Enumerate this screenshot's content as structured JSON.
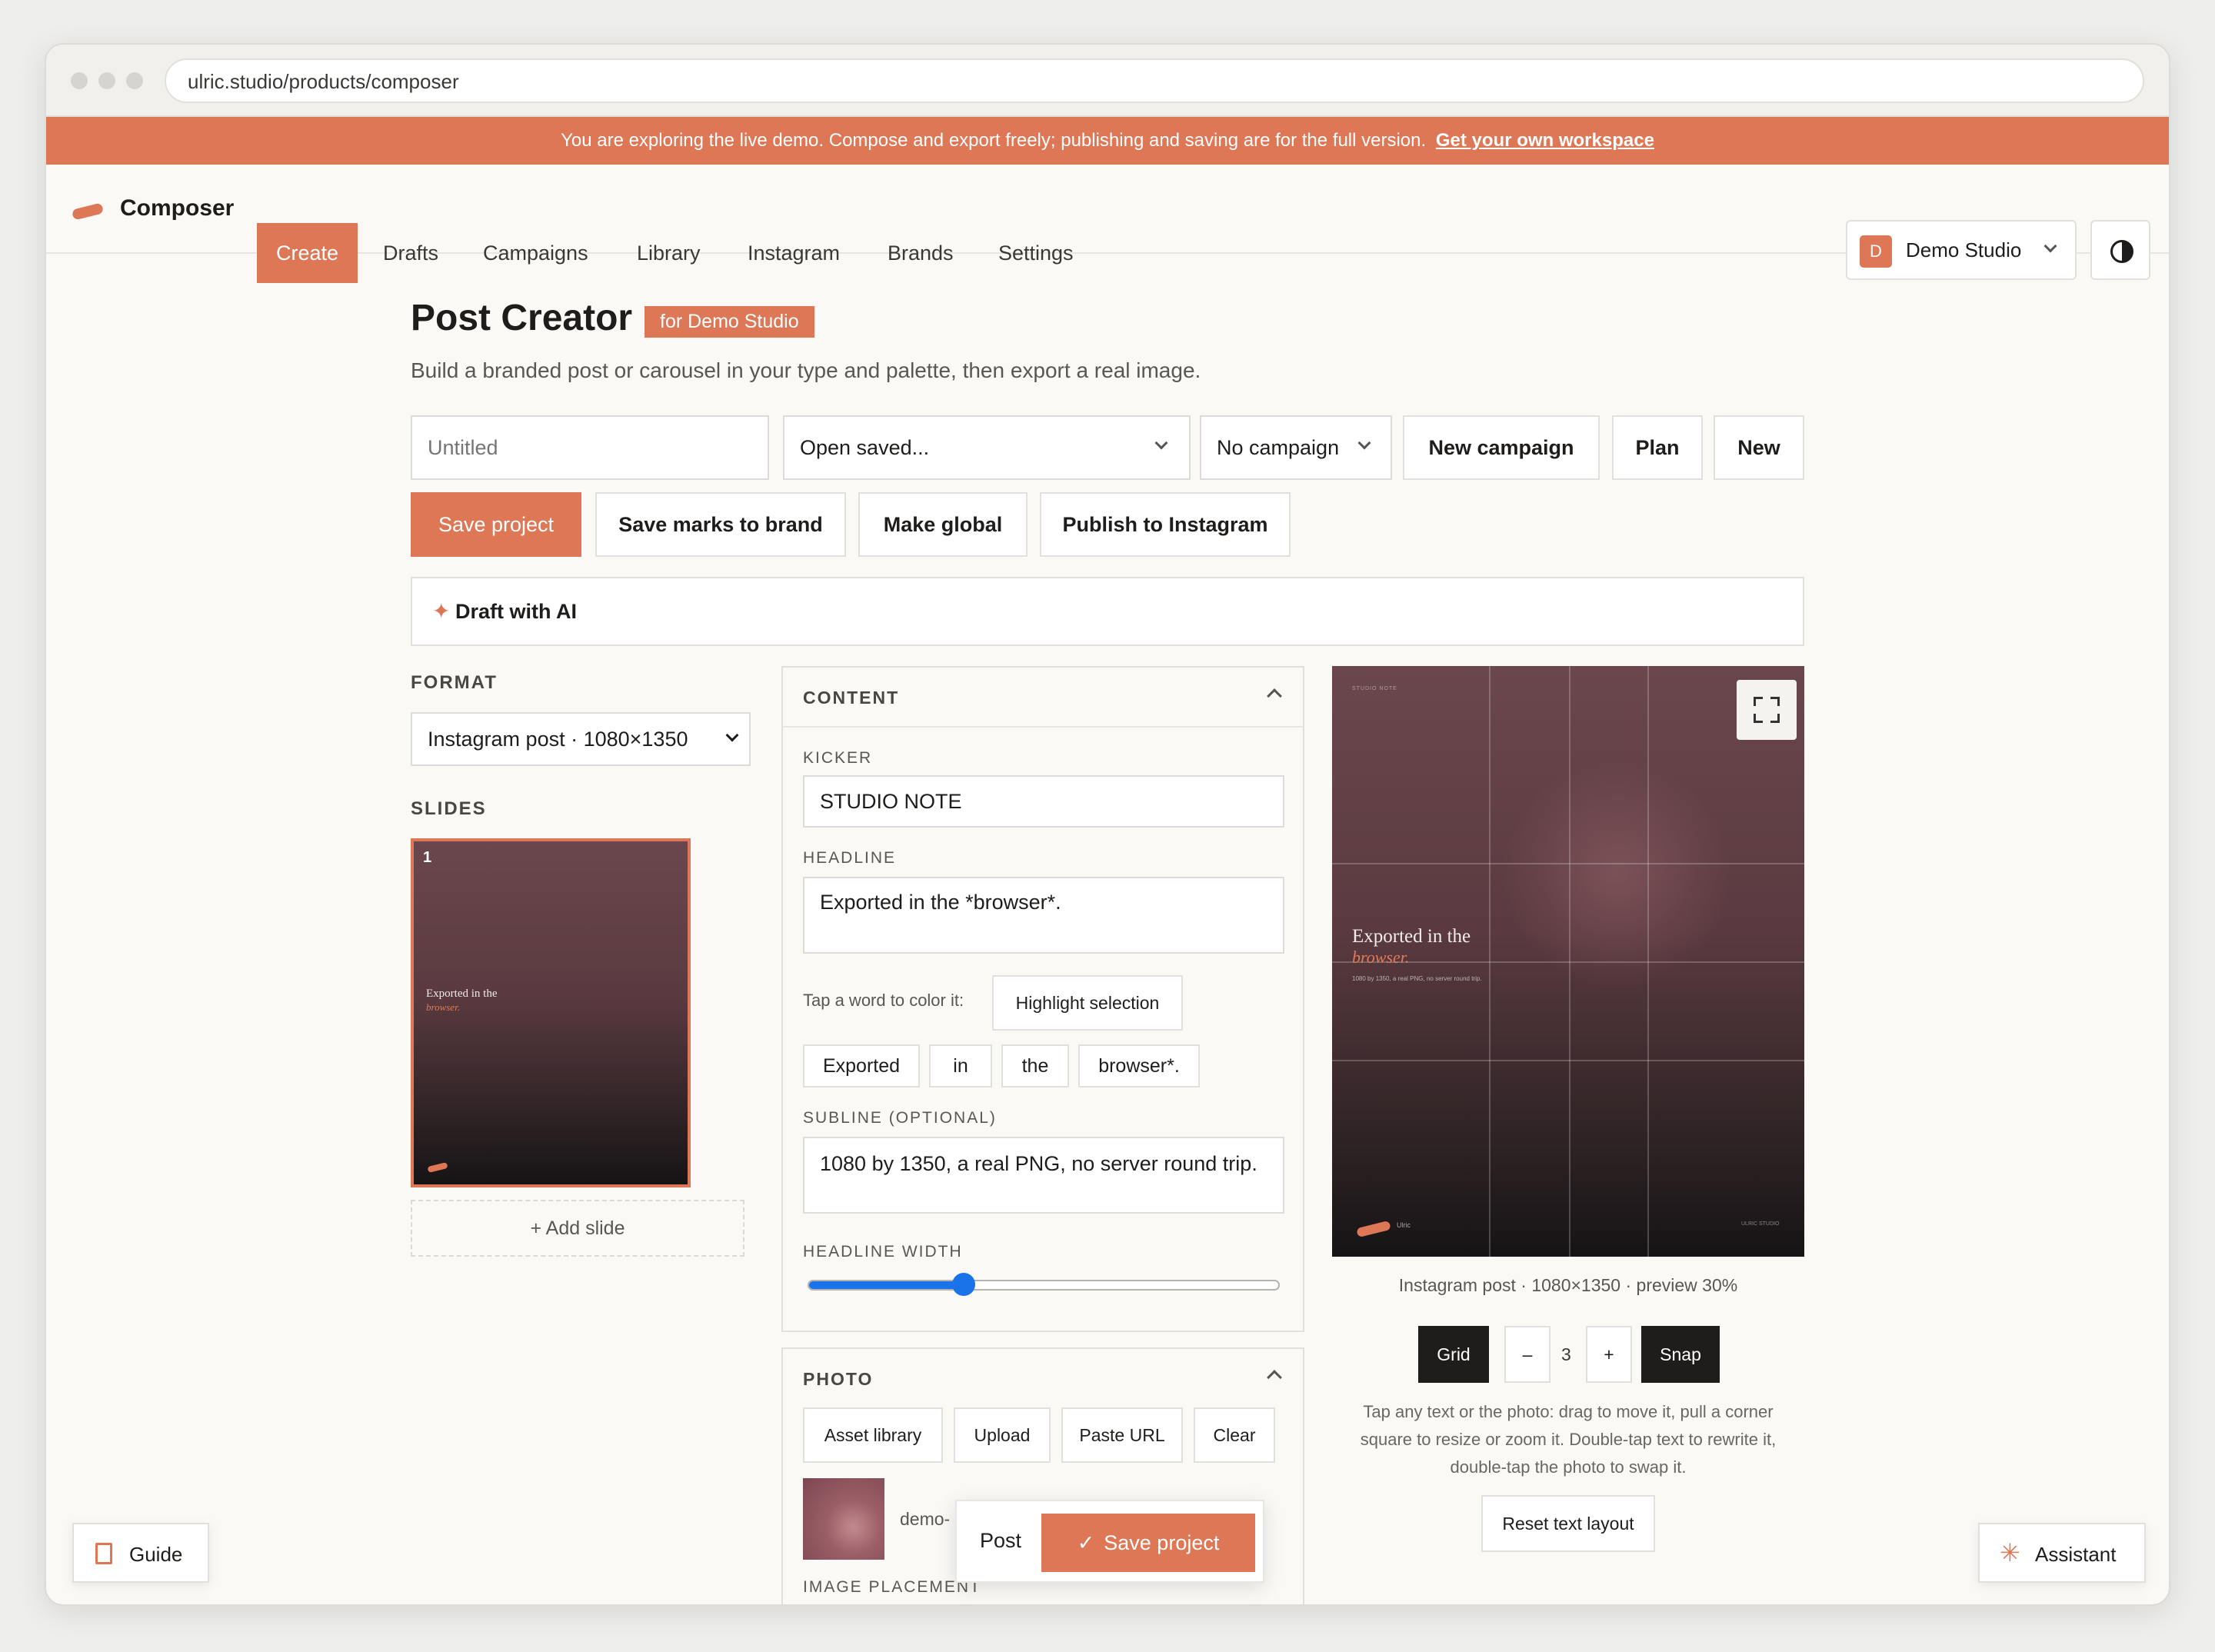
{
  "browser": {
    "url": "ulric.studio/products/composer"
  },
  "banner": {
    "text": "You are exploring the live demo. Compose and export freely; publishing and saving are for the full version.",
    "link": "Get your own workspace"
  },
  "nav": {
    "app_name": "Composer",
    "tabs": [
      "Create",
      "Drafts",
      "Campaigns",
      "Library",
      "Instagram",
      "Brands",
      "Settings"
    ],
    "brand_initial": "D",
    "brand_name": "Demo Studio"
  },
  "header": {
    "title": "Post Creator",
    "badge": "for Demo Studio",
    "subtitle": "Build a branded post or carousel in your type and palette, then export a real image."
  },
  "toolbar": {
    "title_placeholder": "Untitled",
    "open_saved": "Open saved...",
    "campaign": "No campaign",
    "new_campaign": "New campaign",
    "plan": "Plan",
    "new": "New",
    "save_project": "Save project",
    "save_marks": "Save marks to brand",
    "make_global": "Make global",
    "publish": "Publish to Instagram"
  },
  "ai": {
    "label": "Draft with AI"
  },
  "left": {
    "format_label": "FORMAT",
    "format_value": "Instagram post · 1080×1350",
    "slides_label": "SLIDES",
    "slide_number": "1",
    "thumb_headline": "Exported in the",
    "thumb_accent": "browser.",
    "add_slide": "+ Add slide"
  },
  "content": {
    "section_label": "CONTENT",
    "kicker_label": "KICKER",
    "kicker_value": "STUDIO NOTE",
    "headline_label": "HEADLINE",
    "headline_value": "Exported in the *browser*.",
    "tap_hint": "Tap a word to color it:",
    "highlight_btn": "Highlight selection",
    "words": [
      "Exported",
      "in",
      "the",
      "browser*."
    ],
    "subline_label": "SUBLINE (OPTIONAL)",
    "subline_value": "1080 by 1350, a real PNG, no server round trip.",
    "width_label": "HEADLINE WIDTH",
    "width_fraction": 0.33
  },
  "photo": {
    "section_label": "PHOTO",
    "buttons": [
      "Asset library",
      "Upload",
      "Paste URL",
      "Clear"
    ],
    "file_name": "demo-",
    "placement_label": "IMAGE PLACEMENT"
  },
  "floating": {
    "post": "Post",
    "save": "Save project"
  },
  "preview": {
    "kicker": "STUDIO NOTE",
    "headline": "Exported in the",
    "accent": "browser.",
    "subline": "1080 by 1350, a real PNG, no server round trip.",
    "brand": "Ulric",
    "footer_right": "ULRIC STUDIO",
    "caption": "Instagram post · 1080×1350 · preview 30%",
    "grid_btn": "Grid",
    "minus": "–",
    "grid_count": "3",
    "plus": "+",
    "snap_btn": "Snap",
    "help": "Tap any text or the photo: drag to move it, pull a corner square to resize or zoom it. Double-tap text to rewrite it, double-tap the photo to swap it.",
    "reset": "Reset text layout"
  },
  "footer": {
    "guide": "Guide",
    "assistant": "Assistant"
  },
  "colors": {
    "accent": "#dd7755",
    "dark": "#1f1d1b"
  }
}
